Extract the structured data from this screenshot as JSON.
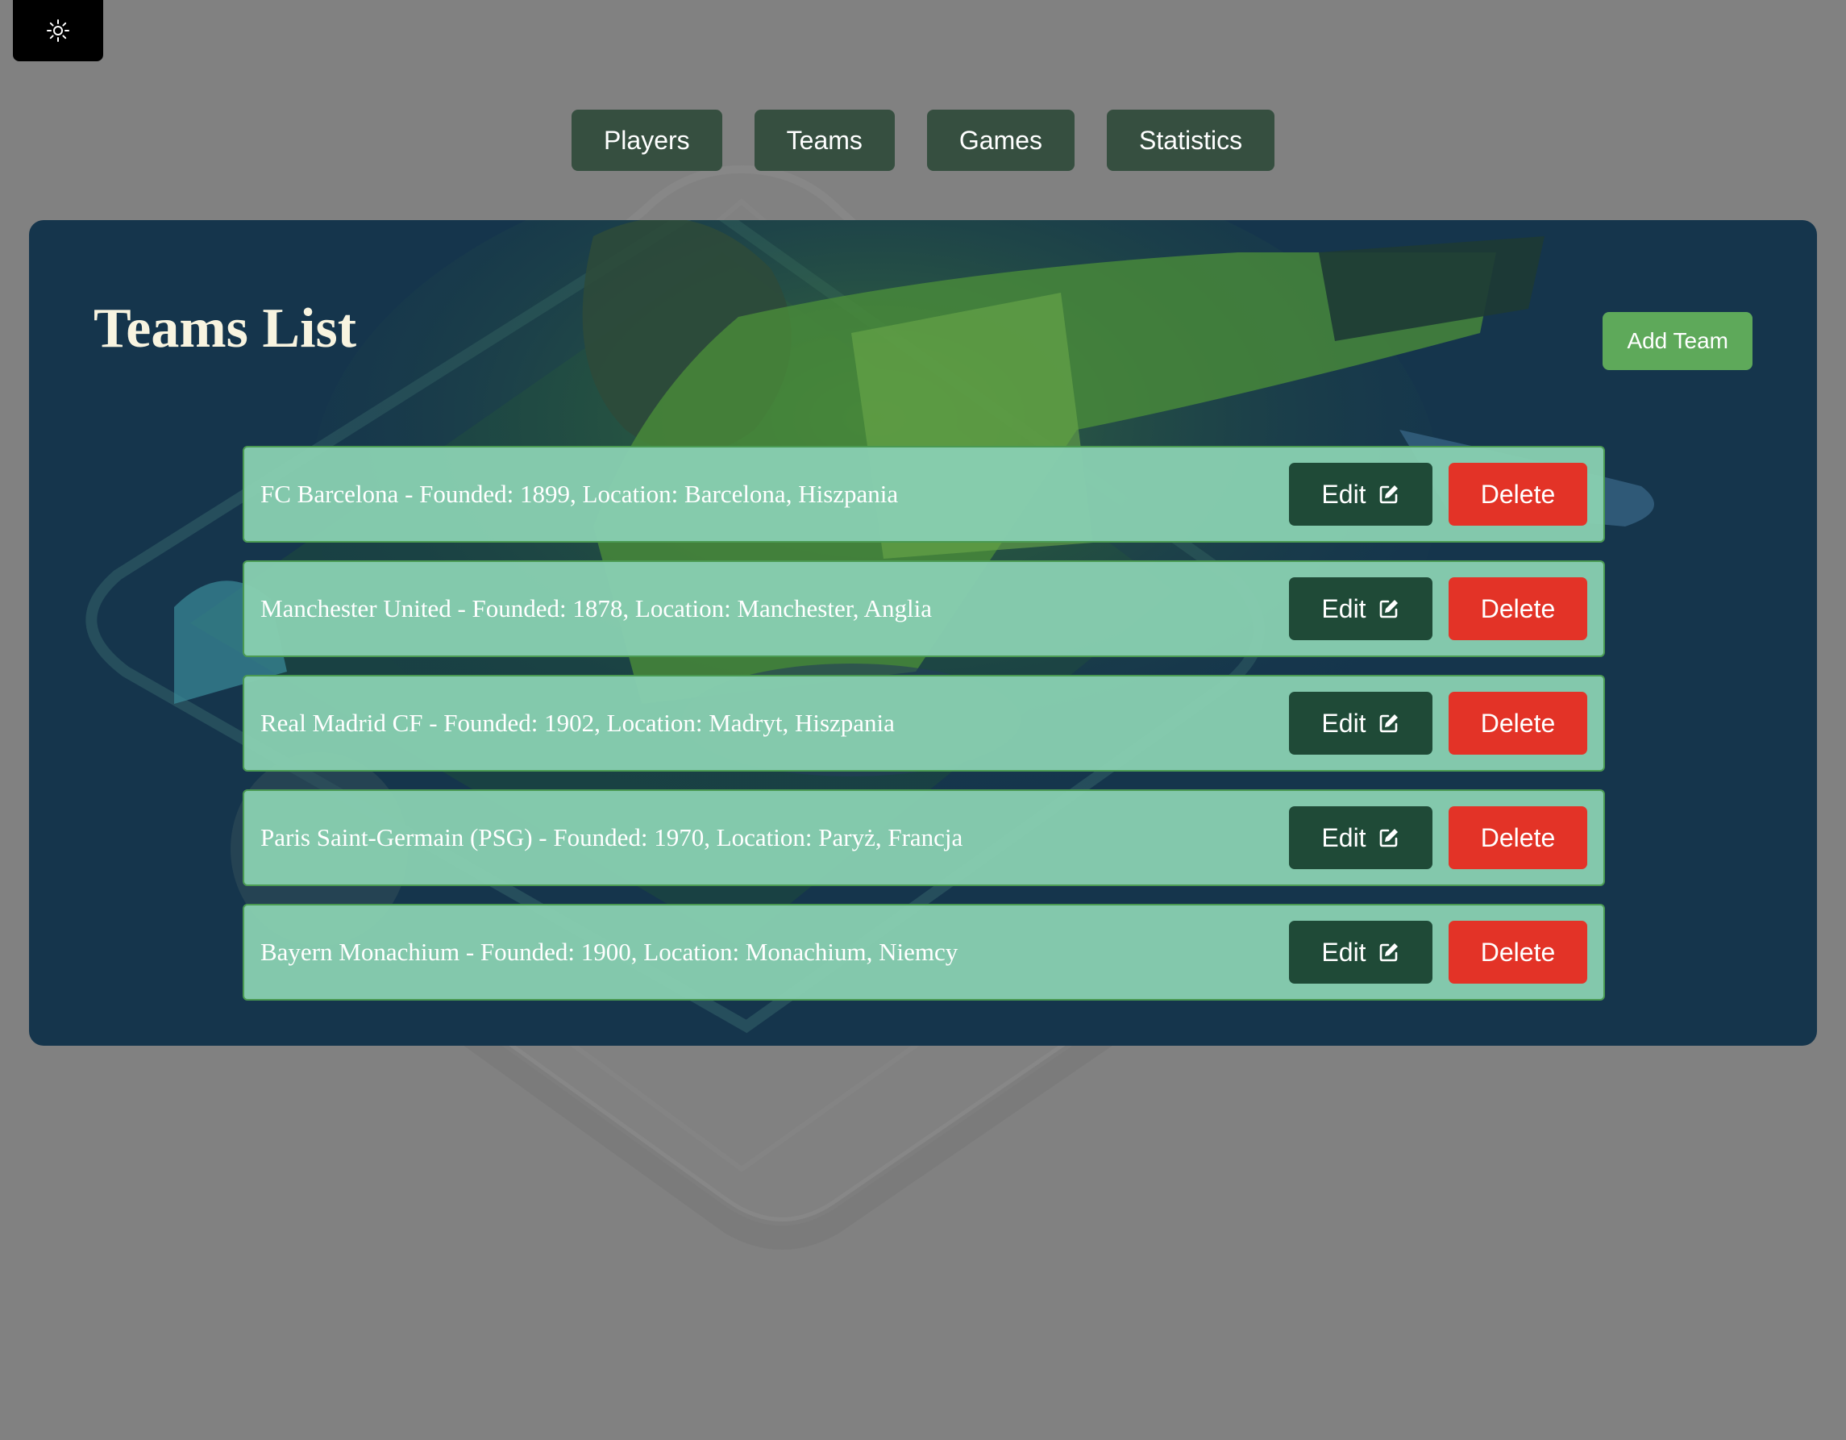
{
  "theme_toggle": {
    "icon": "sun-icon"
  },
  "nav": {
    "items": [
      {
        "label": "Players"
      },
      {
        "label": "Teams"
      },
      {
        "label": "Games"
      },
      {
        "label": "Statistics"
      }
    ]
  },
  "main": {
    "title": "Teams List",
    "add_label": "Add Team",
    "teams": [
      {
        "text": "FC Barcelona - Founded: 1899, Location: Barcelona, Hiszpania",
        "edit_label": "Edit",
        "delete_label": "Delete"
      },
      {
        "text": "Manchester United - Founded: 1878, Location: Manchester, Anglia",
        "edit_label": "Edit",
        "delete_label": "Delete"
      },
      {
        "text": "Real Madrid CF - Founded: 1902, Location: Madryt, Hiszpania",
        "edit_label": "Edit",
        "delete_label": "Delete"
      },
      {
        "text": "Paris Saint-Germain (PSG) - Founded: 1970, Location: Paryż, Francja",
        "edit_label": "Edit",
        "delete_label": "Delete"
      },
      {
        "text": "Bayern Monachium - Founded: 1900, Location: Monachium, Niemcy",
        "edit_label": "Edit",
        "delete_label": "Delete"
      }
    ]
  },
  "colors": {
    "page_bg": "#818181",
    "nav_button": "#364f40",
    "panel_bg": "#15354c",
    "add_button": "#5ea95a",
    "row_bg": "#87cdaf",
    "edit_button": "#1f4a37",
    "delete_button": "#e33327"
  }
}
